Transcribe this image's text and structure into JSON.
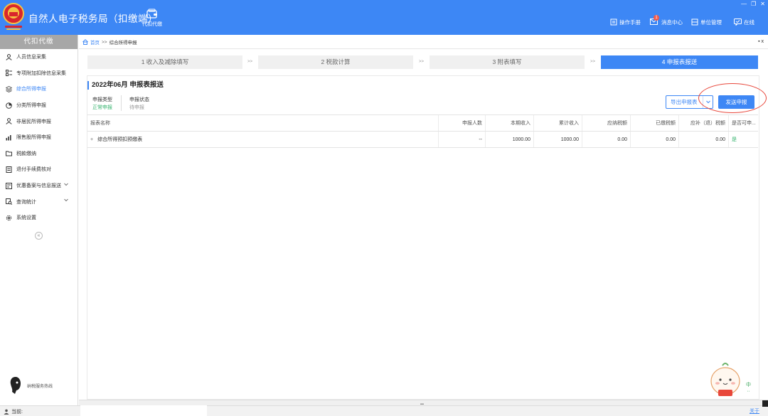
{
  "app": {
    "title": "自然人电子税务局（扣缴端）",
    "emblem_label": "",
    "top_tab": "代扣代缴",
    "top_right": [
      {
        "name": "manual",
        "label": "操作手册"
      },
      {
        "name": "messages",
        "label": "消息中心",
        "badge": "1"
      },
      {
        "name": "unit",
        "label": "单位管理"
      },
      {
        "name": "online",
        "label": "在线"
      }
    ]
  },
  "sidebar": {
    "header": "代扣代缴",
    "items": [
      {
        "label": "人员信息采集",
        "icon": "person-icon"
      },
      {
        "label": "专项附加扣除信息采集",
        "icon": "list-icon"
      },
      {
        "label": "综合所得申报",
        "icon": "layers-icon",
        "active": true
      },
      {
        "label": "分类所得申报",
        "icon": "pie-icon"
      },
      {
        "label": "非居民所得申报",
        "icon": "user-outline-icon"
      },
      {
        "label": "限售股所得申报",
        "icon": "bar-chart-icon"
      },
      {
        "label": "税款缴纳",
        "icon": "folder-icon"
      },
      {
        "label": "退付手续费核对",
        "icon": "receipt-icon"
      },
      {
        "label": "优惠备案与信息报送",
        "icon": "form-icon",
        "expandable": true
      },
      {
        "label": "查询统计",
        "icon": "search-doc-icon",
        "expandable": true
      },
      {
        "label": "系统设置",
        "icon": "gear-icon"
      }
    ],
    "collapse": "«",
    "hotline": "纳税服务热线"
  },
  "breadcrumb": {
    "home": "首页",
    "sep": ">>",
    "current": "综合所得申报",
    "close": "▪ x"
  },
  "steps": [
    {
      "label": "1 收入及减除填写"
    },
    {
      "label": "2 税款计算"
    },
    {
      "label": "3 附表填写"
    },
    {
      "label": "4 申报表报送",
      "active": true
    }
  ],
  "step_sep": ">>",
  "panel": {
    "title": "2022年06月  申报表报送",
    "decl_type_label": "申报类型",
    "decl_type_value": "正常申报",
    "decl_status_label": "申报状态",
    "decl_status_value": "待申报",
    "export_label": "导出申报表",
    "send_label": "发送申报"
  },
  "table": {
    "headers": [
      "报表名称",
      "申报人数",
      "本期收入",
      "累计收入",
      "应纳税额",
      "已缴税额",
      "应补（退）税额",
      "是否可申..."
    ],
    "rows": [
      {
        "expand": "+",
        "name": "综合所得预扣预缴表",
        "count": "--",
        "current_income": "1000.00",
        "cumulative_income": "1000.00",
        "tax_payable": "0.00",
        "tax_paid": "0.00",
        "tax_due": "0.00",
        "can_declare": "是"
      }
    ]
  },
  "status": {
    "user": "当前:",
    "link": "关于"
  },
  "ime": {
    "lang": "中",
    "mode": "··"
  },
  "colors": {
    "brand": "#3d87f5",
    "green": "#36b36e",
    "annotation": "#e8473b"
  }
}
